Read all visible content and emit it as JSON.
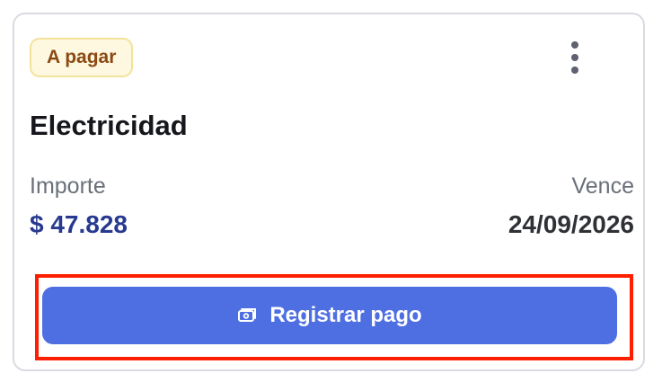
{
  "card": {
    "badge": "A pagar",
    "title": "Electricidad",
    "amount_label": "Importe",
    "amount_value": "$ 47.828",
    "due_label": "Vence",
    "due_value": "24/09/2026",
    "action_label": "Registrar pago",
    "action_icon": "cash-icon",
    "menu_icon": "more-vertical-icon"
  },
  "colors": {
    "badge_bg": "#fef8e1",
    "badge_text": "#8a4a12",
    "amount": "#283a8f",
    "button": "#4e6fe2",
    "highlight": "#ff1f00"
  }
}
